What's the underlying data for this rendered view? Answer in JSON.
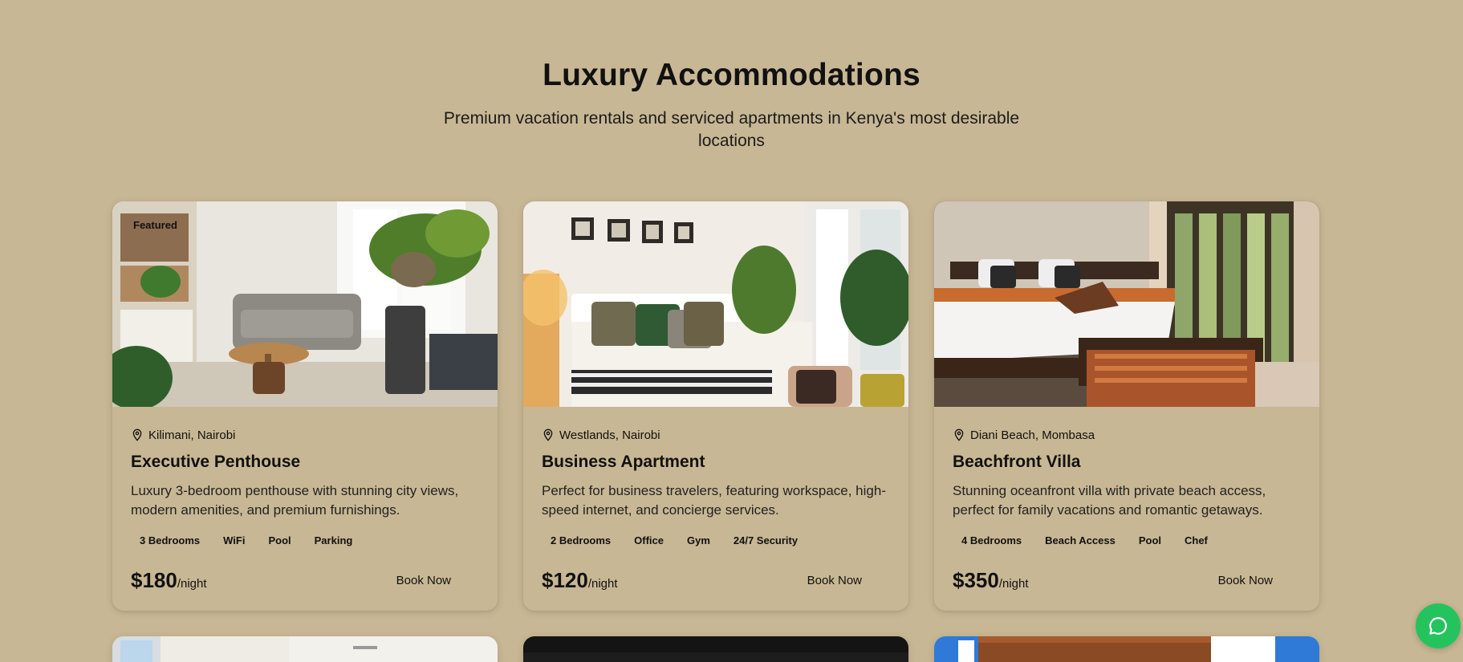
{
  "header": {
    "title": "Luxury Accommodations",
    "subtitle": "Premium vacation rentals and serviced apartments in Kenya's most desirable locations"
  },
  "listings": [
    {
      "badge": "Featured",
      "location": "Kilimani, Nairobi",
      "name": "Executive Penthouse",
      "description": "Luxury 3-bedroom penthouse with stunning city views, modern amenities, and premium furnishings.",
      "tags": [
        "3 Bedrooms",
        "WiFi",
        "Pool",
        "Parking"
      ],
      "price": "$180",
      "per": "/night",
      "button": "Book Now"
    },
    {
      "location": "Westlands, Nairobi",
      "name": "Business Apartment",
      "description": "Perfect for business travelers, featuring workspace, high-speed internet, and concierge services.",
      "tags": [
        "2 Bedrooms",
        "Office",
        "Gym",
        "24/7 Security"
      ],
      "price": "$120",
      "per": "/night",
      "button": "Book Now"
    },
    {
      "location": "Diani Beach, Mombasa",
      "name": "Beachfront Villa",
      "description": "Stunning oceanfront villa with private beach access, perfect for family vacations and romantic getaways.",
      "tags": [
        "4 Bedrooms",
        "Beach Access",
        "Pool",
        "Chef"
      ],
      "price": "$350",
      "per": "/night",
      "button": "Book Now"
    }
  ],
  "icons": {
    "location": "map-pin-icon",
    "chat": "chat-bubble-icon"
  },
  "colors": {
    "background": "#c8b794",
    "chat_button": "#25c35e"
  }
}
